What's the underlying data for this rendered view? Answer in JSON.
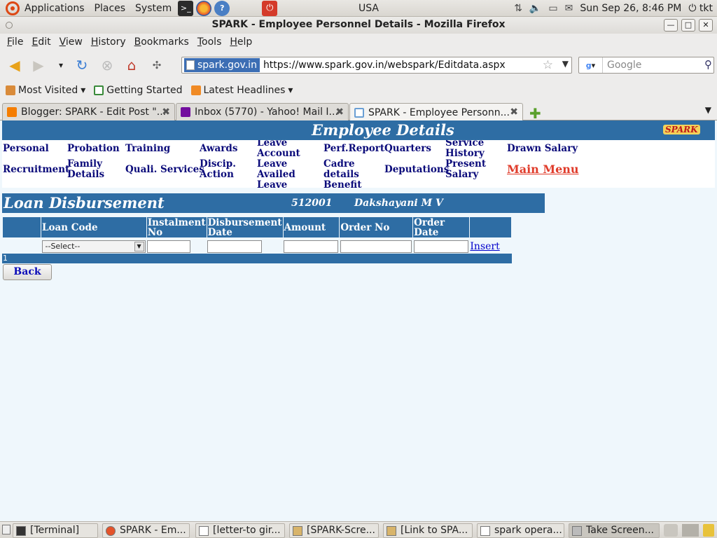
{
  "top_panel": {
    "menus": [
      "Applications",
      "Places",
      "System"
    ],
    "center_text": "USA",
    "clock": "Sun Sep 26,  8:46 PM",
    "user": "tkt"
  },
  "window": {
    "title": "SPARK - Employee Personnel Details - Mozilla Firefox"
  },
  "menubar": {
    "items": [
      {
        "label": "File",
        "key": "F",
        "rest": "ile"
      },
      {
        "label": "Edit",
        "key": "E",
        "rest": "dit"
      },
      {
        "label": "View",
        "key": "V",
        "rest": "iew"
      },
      {
        "label": "History",
        "key": "H",
        "rest": "istory"
      },
      {
        "label": "Bookmarks",
        "key": "B",
        "rest": "ookmarks"
      },
      {
        "label": "Tools",
        "key": "T",
        "rest": "ools"
      },
      {
        "label": "Help",
        "key": "H",
        "rest": "elp"
      }
    ]
  },
  "navbar": {
    "site_identity": "spark.gov.in",
    "url": "https://www.spark.gov.in/webspark/Editdata.aspx",
    "search_placeholder": "Google"
  },
  "bookmarks": {
    "items": [
      "Most Visited",
      "Getting Started",
      "Latest Headlines"
    ]
  },
  "tabs": [
    {
      "label": "Blogger: SPARK - Edit Post \"...",
      "active": false,
      "icon_color": "#f57d00"
    },
    {
      "label": "Inbox (5770) - Yahoo! Mail I...",
      "active": false,
      "icon_color": "#720e9e"
    },
    {
      "label": "SPARK - Employee Personn...",
      "active": true,
      "icon_color": "#6a9fd4"
    }
  ],
  "page": {
    "header_title": "Employee Details",
    "logo_text": "SPARK",
    "nav_links": {
      "personal": "Personal",
      "probation": "Probation",
      "training": "Training",
      "awards": "Awards",
      "leave_account": "Leave Account",
      "perf_report": "Perf.Report",
      "quarters": "Quarters",
      "service_history": "Service History",
      "drawn_salary": "Drawn Salary",
      "recruitment": "Recruitment",
      "family_details": "Family Details",
      "quali_services": "Quali. Services",
      "discip_action": "Discip. Action",
      "leave_availed": "Leave Availed",
      "cadre_details": "Cadre details",
      "deputations": "Deputations",
      "present_salary": "Present Salary",
      "main_menu": "Main Menu",
      "leave_row3": "Leave",
      "benefit": "Benefit"
    },
    "section_title": "Loan Disbursement",
    "employee_id": "512001",
    "employee_name": "Dakshayani M V",
    "table": {
      "headers": [
        "Loan Code",
        "Instalment No",
        "Disbursement Date",
        "Amount",
        "Order No",
        "Order Date"
      ],
      "loan_code_select": "--Select--",
      "insert_label": "Insert",
      "pager": "1"
    },
    "back_label": "Back"
  },
  "taskbar": {
    "items": [
      {
        "label": "[Terminal]",
        "active": false
      },
      {
        "label": "SPARK - Em...",
        "active": false
      },
      {
        "label": "[letter-to gir...",
        "active": false
      },
      {
        "label": "[SPARK-Scre...",
        "active": false
      },
      {
        "label": "[Link to SPA...",
        "active": false
      },
      {
        "label": "spark opera...",
        "active": false
      },
      {
        "label": "Take Screen...",
        "active": true
      }
    ]
  }
}
